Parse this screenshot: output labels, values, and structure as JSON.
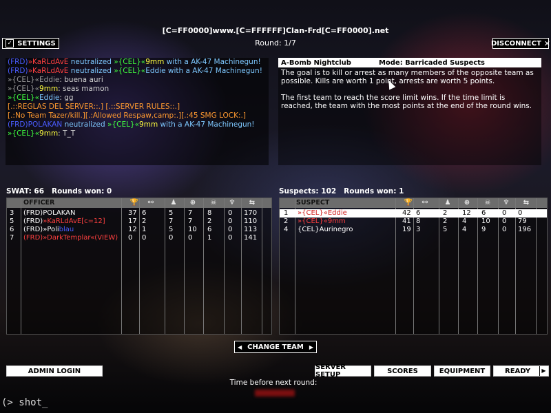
{
  "header": {
    "title": "[C=FF0000]www.[C=FFFFFF]Clan-Frd[C=FF0000].net",
    "round": "Round: 1/7"
  },
  "buttons": {
    "settings": "SETTINGS",
    "disconnect": "DISCONNECT",
    "change_team": "CHANGE TEAM",
    "admin_login": "ADMIN LOGIN",
    "server_setup": "SERVER SETUP",
    "scores": "SCORES",
    "equipment": "EQUIPMENT",
    "ready": "READY"
  },
  "chat": [
    {
      "segments": [
        {
          "t": "(FRD)",
          "c": "#4a5cff"
        },
        {
          "t": "»KaRLdAvE ",
          "c": "#ff4040"
        },
        {
          "t": "neutralized ",
          "c": "#7ec8ff"
        },
        {
          "t": "»{CEL}«",
          "c": "#40ff40"
        },
        {
          "t": "9mm ",
          "c": "#ffff40"
        },
        {
          "t": "with a AK-47 Machinegun!",
          "c": "#7ec8ff"
        }
      ]
    },
    {
      "segments": [
        {
          "t": "(FRD)",
          "c": "#4a5cff"
        },
        {
          "t": "»KaRLdAvE ",
          "c": "#ff4040"
        },
        {
          "t": "neutralized ",
          "c": "#7ec8ff"
        },
        {
          "t": "»{CEL}«",
          "c": "#40ff40"
        },
        {
          "t": "Eddie ",
          "c": "#7ec8ff"
        },
        {
          "t": "with a AK-47 Machinegun!",
          "c": "#7ec8ff"
        }
      ]
    },
    {
      "segments": [
        {
          "t": "»{CEL}«",
          "c": "#9a9a9a"
        },
        {
          "t": "Eddie",
          "c": "#9a9a9a"
        },
        {
          "t": ": buena auri",
          "c": "#cfcfcf"
        }
      ]
    },
    {
      "segments": [
        {
          "t": "»{CEL}«",
          "c": "#9a9a9a"
        },
        {
          "t": "9mm",
          "c": "#ffff40"
        },
        {
          "t": ": seas mamon",
          "c": "#cfcfcf"
        }
      ]
    },
    {
      "segments": [
        {
          "t": "»{CEL}«",
          "c": "#40ff40"
        },
        {
          "t": "Eddie",
          "c": "#7ec8ff"
        },
        {
          "t": ": gg",
          "c": "#cfcfcf"
        }
      ]
    },
    {
      "segments": [
        {
          "t": "[.::REGLAS DEL SERVER::.] [.::SERVER RULES::.]",
          "c": "#ff9a30"
        }
      ]
    },
    {
      "segments": [
        {
          "t": "[.:No Team Tazer/kill.][.:Allowed Respaw,camp:.][.:45 SMG LOCK:.]",
          "c": "#ff9a30"
        }
      ]
    },
    {
      "segments": [
        {
          "t": "(FRD)POLAKAN ",
          "c": "#4a5cff"
        },
        {
          "t": "neutralized ",
          "c": "#7ec8ff"
        },
        {
          "t": "»{CEL}«",
          "c": "#40ff40"
        },
        {
          "t": "9mm ",
          "c": "#ffff40"
        },
        {
          "t": "with a AK-47 Machinegun!",
          "c": "#7ec8ff"
        }
      ]
    },
    {
      "segments": [
        {
          "t": "»{CEL}«",
          "c": "#40ff40"
        },
        {
          "t": "9mm",
          "c": "#ffff40"
        },
        {
          "t": ": T_T",
          "c": "#cfcfcf"
        }
      ]
    }
  ],
  "info": {
    "map": "A-Bomb Nightclub",
    "mode": "Mode: Barricaded Suspects",
    "paragraph1": "The goal is to kill or arrest as many members of the opposite team as possible.  Kills are worth 1 point, arrests are worth 5 points.",
    "paragraph2": "The first team to reach the score limit wins.  If the time limit is reached, the team with the most points at the end of the round wins."
  },
  "swat": {
    "label": "SWAT: 66   Rounds won: 0",
    "column_header": "OFFICER",
    "rows": [
      {
        "num": "3",
        "name": [
          {
            "t": "(FRD)POLAKAN",
            "c": "#ffffff"
          }
        ],
        "score": "37",
        "a": "6",
        "b": "5",
        "c": "7",
        "d": "8",
        "e": "0",
        "ping": "170"
      },
      {
        "num": "5",
        "name": [
          {
            "t": "(FRD)",
            "c": "#ffffff"
          },
          {
            "t": "»KaRLdAvE[c=12]",
            "c": "#ff4040"
          }
        ],
        "score": "17",
        "a": "2",
        "b": "7",
        "c": "7",
        "d": "2",
        "e": "0",
        "ping": "110"
      },
      {
        "num": "6",
        "name": [
          {
            "t": "(FRD)»Poli",
            "c": "#ffffff"
          },
          {
            "t": "blau",
            "c": "#4a5cff"
          }
        ],
        "score": "12",
        "a": "1",
        "b": "5",
        "c": "10",
        "d": "6",
        "e": "0",
        "ping": "113"
      },
      {
        "num": "7",
        "name": [
          {
            "t": "(FRD)»DarkTemplar«(VIEW)",
            "c": "#ff4040"
          }
        ],
        "score": "0",
        "a": "0",
        "b": "0",
        "c": "0",
        "d": "1",
        "e": "0",
        "ping": "141"
      }
    ]
  },
  "suspects": {
    "label": "Suspects: 102   Rounds won: 1",
    "column_header": "SUSPECT",
    "rows": [
      {
        "num": "1",
        "name": [
          {
            "t": "»{CEL}«Eddie",
            "c": "#d02020"
          }
        ],
        "score": "42",
        "a": "6",
        "b": "2",
        "c": "12",
        "d": "6",
        "e": "0",
        "ping": "0",
        "selected": true
      },
      {
        "num": "2",
        "name": [
          {
            "t": "»{CEL}«9mm",
            "c": "#ff4040"
          }
        ],
        "score": "41",
        "a": "8",
        "b": "2",
        "c": "4",
        "d": "10",
        "e": "0",
        "ping": "79"
      },
      {
        "num": "4",
        "name": [
          {
            "t": "{CEL}Aurinegro",
            "c": "#ffffff"
          }
        ],
        "score": "19",
        "a": "3",
        "b": "5",
        "c": "4",
        "d": "9",
        "e": "0",
        "ping": "196"
      }
    ]
  },
  "footer": {
    "time_before_next": "Time before next round:",
    "console": "(> shot_"
  },
  "icons": {
    "col1": "trophy-icon",
    "col2": "handcuffs-icon",
    "col3": "arrested-icon",
    "col4": "crosshair-icon",
    "col5": "skull-icon",
    "col6": "badge-icon",
    "col7": "ping-icon"
  }
}
